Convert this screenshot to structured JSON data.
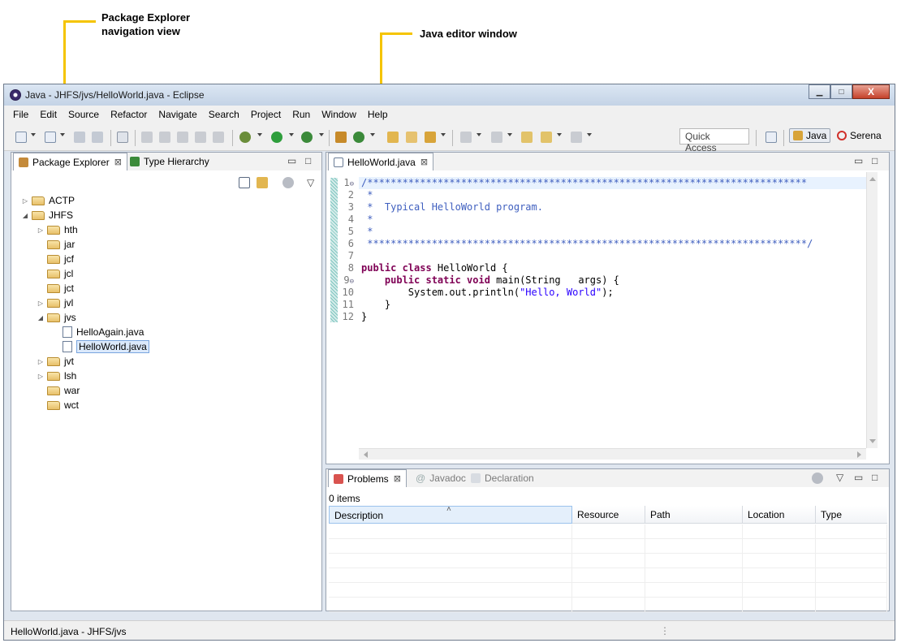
{
  "callouts": {
    "package_explorer_line1": "Package Explorer",
    "package_explorer_line2": "navigation view",
    "editor": "Java editor window"
  },
  "window": {
    "title": "Java - JHFS/jvs/HelloWorld.java - Eclipse",
    "minimize_glyph": "▁",
    "maximize_glyph": "□",
    "close_glyph": "X"
  },
  "menu": [
    "File",
    "Edit",
    "Source",
    "Refactor",
    "Navigate",
    "Search",
    "Project",
    "Run",
    "Window",
    "Help"
  ],
  "toolbar": {
    "quick_access_placeholder": "Quick Access",
    "perspective_java": "Java",
    "perspective_serena": "Serena"
  },
  "package_explorer": {
    "tabs": [
      {
        "label": "Package Explorer",
        "close": "⊠",
        "active": true
      },
      {
        "label": "Type Hierarchy",
        "active": false
      }
    ],
    "minimize_glyph": "▭",
    "maximize_glyph": "□",
    "menu_glyph": "▽",
    "tree": [
      {
        "label": "ACTP",
        "twisty": "▷",
        "type": "folder",
        "depth": 0
      },
      {
        "label": "JHFS",
        "twisty": "◢",
        "type": "folder",
        "depth": 0
      },
      {
        "label": "hth",
        "twisty": "▷",
        "type": "folder",
        "depth": 1
      },
      {
        "label": "jar",
        "twisty": "",
        "type": "folder",
        "depth": 1
      },
      {
        "label": "jcf",
        "twisty": "",
        "type": "folder",
        "depth": 1
      },
      {
        "label": "jcl",
        "twisty": "",
        "type": "folder",
        "depth": 1
      },
      {
        "label": "jct",
        "twisty": "",
        "type": "folder",
        "depth": 1
      },
      {
        "label": "jvl",
        "twisty": "▷",
        "type": "folder",
        "depth": 1
      },
      {
        "label": "jvs",
        "twisty": "◢",
        "type": "folder",
        "depth": 1
      },
      {
        "label": "HelloAgain.java",
        "twisty": "",
        "type": "file",
        "depth": 2
      },
      {
        "label": "HelloWorld.java",
        "twisty": "",
        "type": "file",
        "depth": 2,
        "selected": true
      },
      {
        "label": "jvt",
        "twisty": "▷",
        "type": "folder",
        "depth": 1
      },
      {
        "label": "lsh",
        "twisty": "▷",
        "type": "folder",
        "depth": 1
      },
      {
        "label": "war",
        "twisty": "",
        "type": "folder",
        "depth": 1
      },
      {
        "label": "wct",
        "twisty": "",
        "type": "folder",
        "depth": 1
      }
    ]
  },
  "editor": {
    "tab_label": "HelloWorld.java",
    "tab_close": "⊠",
    "minimize_glyph": "▭",
    "maximize_glyph": "□",
    "lines": [
      {
        "n": "1",
        "fold": "⊖",
        "segments": [
          {
            "cls": "cm",
            "text": "/***************************************************************************"
          }
        ]
      },
      {
        "n": "2",
        "fold": "",
        "segments": [
          {
            "cls": "cm",
            "text": " *"
          }
        ]
      },
      {
        "n": "3",
        "fold": "",
        "segments": [
          {
            "cls": "cm",
            "text": " *  Typical HelloWorld program."
          }
        ]
      },
      {
        "n": "4",
        "fold": "",
        "segments": [
          {
            "cls": "cm",
            "text": " *"
          }
        ]
      },
      {
        "n": "5",
        "fold": "",
        "segments": [
          {
            "cls": "cm",
            "text": " *"
          }
        ]
      },
      {
        "n": "6",
        "fold": "",
        "segments": [
          {
            "cls": "cm",
            "text": " ***************************************************************************/"
          }
        ]
      },
      {
        "n": "7",
        "fold": "",
        "segments": []
      },
      {
        "n": "8",
        "fold": "",
        "segments": [
          {
            "cls": "kw",
            "text": "public class"
          },
          {
            "cls": "",
            "text": " HelloWorld {"
          }
        ]
      },
      {
        "n": "9",
        "fold": "⊖",
        "segments": [
          {
            "cls": "",
            "text": "    "
          },
          {
            "cls": "kw",
            "text": "public static void"
          },
          {
            "cls": "",
            "text": " main(String   args) {"
          }
        ]
      },
      {
        "n": "10",
        "fold": "",
        "segments": [
          {
            "cls": "",
            "text": "        System.out.println("
          },
          {
            "cls": "str",
            "text": "\"Hello, World\""
          },
          {
            "cls": "",
            "text": ");"
          }
        ]
      },
      {
        "n": "11",
        "fold": "",
        "segments": [
          {
            "cls": "",
            "text": "    }"
          }
        ]
      },
      {
        "n": "12",
        "fold": "",
        "segments": [
          {
            "cls": "",
            "text": "}"
          }
        ]
      }
    ]
  },
  "problems": {
    "tabs": [
      {
        "label": "Problems",
        "close": "⊠",
        "active": true
      },
      {
        "label": "Javadoc",
        "active": false
      },
      {
        "label": "Declaration",
        "active": false
      }
    ],
    "menu_glyph": "▽",
    "minimize_glyph": "▭",
    "maximize_glyph": "□",
    "count": "0 items",
    "sort_glyph": "˄",
    "columns": [
      "Description",
      "Resource",
      "Path",
      "Location",
      "Type"
    ]
  },
  "status": {
    "text": "HelloWorld.java - JHFS/jvs",
    "grip": "⋮"
  }
}
